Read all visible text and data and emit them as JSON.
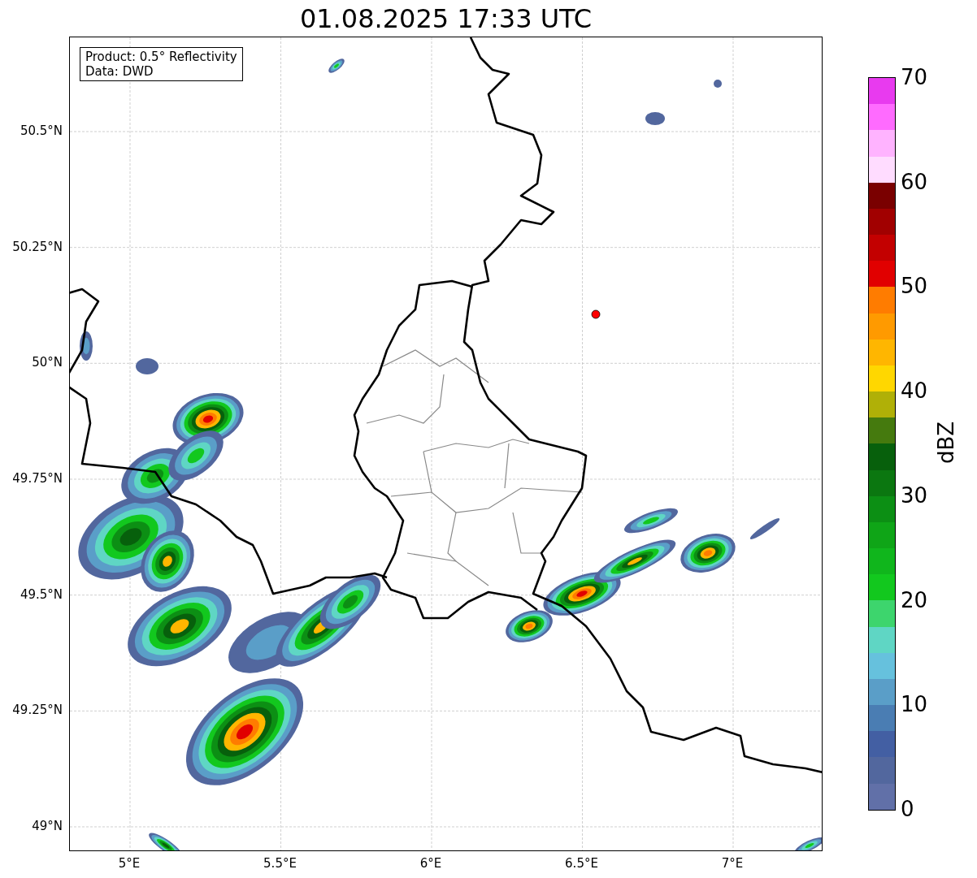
{
  "title": "01.08.2025 17:33 UTC",
  "info_box": [
    "Product: 0.5° Reflectivity",
    "Data: DWD"
  ],
  "map": {
    "lat_labels": [
      "50.5°N",
      "50.25°N",
      "50°N",
      "49.75°N",
      "49.5°N",
      "49.25°N",
      "49°N"
    ],
    "lon_labels": [
      "5°E",
      "5.5°E",
      "6°E",
      "6.5°E",
      "7°E"
    ]
  },
  "colorbar": {
    "label": "dBZ",
    "tick_labels": [
      "70",
      "60",
      "50",
      "40",
      "30",
      "20",
      "10",
      "0"
    ],
    "segments": [
      {
        "color": "#e83aef"
      },
      {
        "color": "#ff6bff"
      },
      {
        "color": "#ffb3ff"
      },
      {
        "color": "#ffdcff"
      },
      {
        "color": "#7a0000"
      },
      {
        "color": "#a10000"
      },
      {
        "color": "#c30000"
      },
      {
        "color": "#e10000"
      },
      {
        "color": "#ff7c00"
      },
      {
        "color": "#ff9a00"
      },
      {
        "color": "#ffb600"
      },
      {
        "color": "#ffd700"
      },
      {
        "color": "#b0b007"
      },
      {
        "color": "#457a0e"
      },
      {
        "color": "#07600c"
      },
      {
        "color": "#0b7710"
      },
      {
        "color": "#0c8f14"
      },
      {
        "color": "#0fa517"
      },
      {
        "color": "#10b61c"
      },
      {
        "color": "#12c81e"
      },
      {
        "color": "#3dd56d"
      },
      {
        "color": "#5fd6c4"
      },
      {
        "color": "#66c1dd"
      },
      {
        "color": "#5a9ec8"
      },
      {
        "color": "#4a7db3"
      },
      {
        "color": "#435fa3"
      },
      {
        "color": "#52679e"
      },
      {
        "color": "#6170a8"
      }
    ]
  }
}
